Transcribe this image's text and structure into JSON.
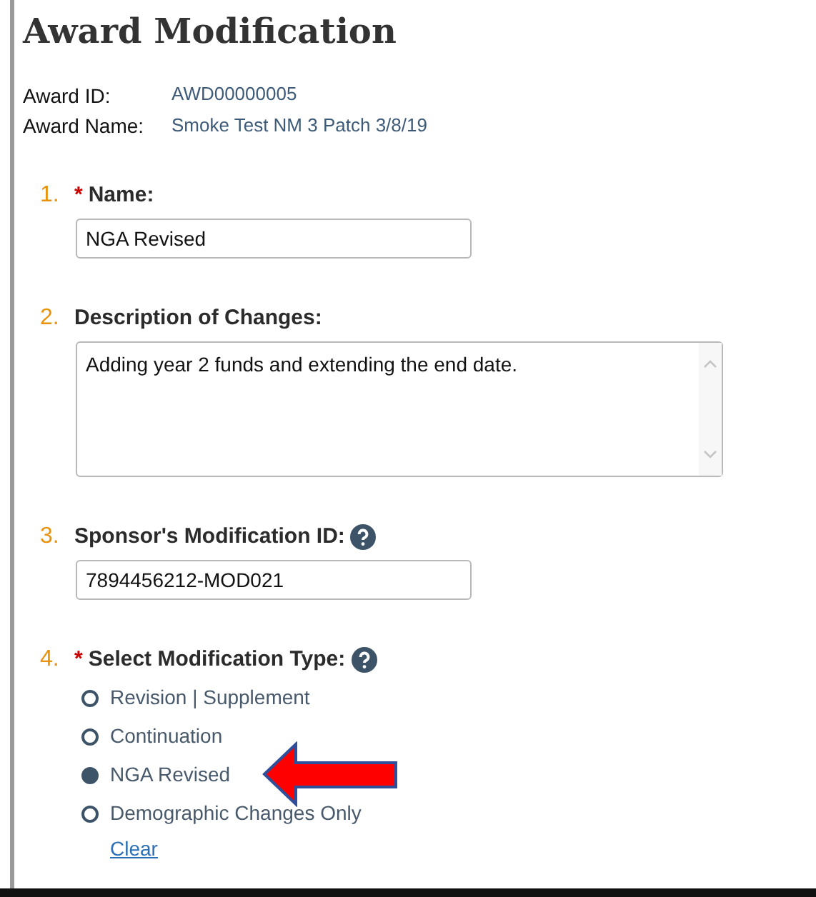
{
  "page": {
    "title": "Award Modification"
  },
  "award": [
    {
      "label": "Award ID:",
      "value": "AWD00000005"
    },
    {
      "label": "Award Name:",
      "value": "Smoke Test NM 3 Patch 3/8/19"
    }
  ],
  "questions": [
    {
      "kind": "text",
      "number": "1.",
      "required_mark": "*",
      "help": false,
      "label": "Name:",
      "value": "NGA Revised"
    },
    {
      "kind": "textarea",
      "number": "2.",
      "help": false,
      "label": "Description of Changes:",
      "value": "Adding year 2 funds and extending the end date."
    },
    {
      "kind": "text",
      "number": "3.",
      "help": true,
      "label": "Sponsor's Modification ID:",
      "value": "7894456212-MOD021"
    },
    {
      "kind": "radio",
      "number": "4.",
      "required_mark": "*",
      "help": true,
      "label": "Select Modification Type:",
      "options": [
        {
          "label": "Revision | Supplement",
          "selected": false
        },
        {
          "label": "Continuation",
          "selected": false
        },
        {
          "label": "NGA Revised",
          "selected": true
        },
        {
          "label": "Demographic Changes Only",
          "selected": false
        }
      ],
      "clear_link": "Clear"
    }
  ]
}
